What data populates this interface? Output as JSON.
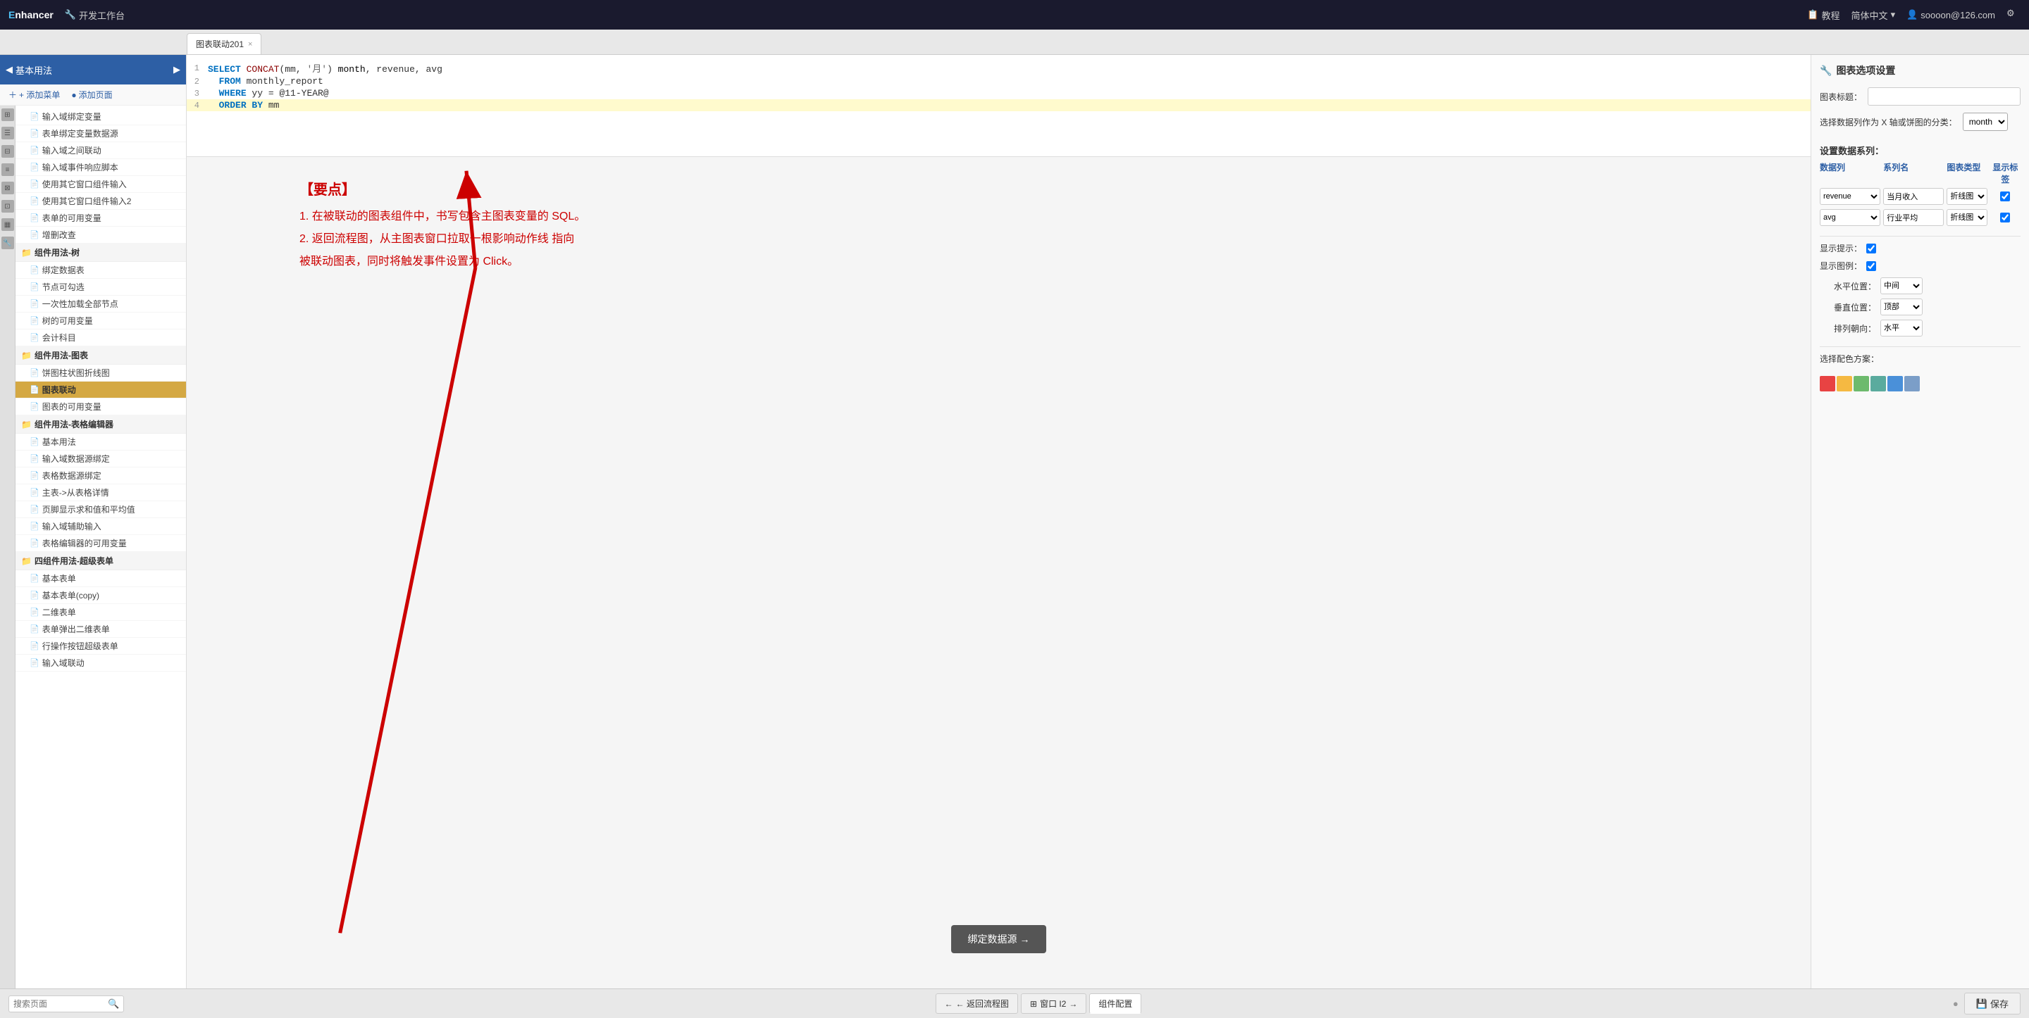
{
  "topbar": {
    "logo": "nhancer",
    "logo_prefix": "E",
    "workbench_icon": "🔧",
    "workbench_label": "开发工作台",
    "tutorial_label": "教程",
    "lang_label": "简体中文",
    "user_label": "soooon@126.com"
  },
  "tab": {
    "label": "图表联动201",
    "close": "×"
  },
  "sidebar": {
    "header": "基本用法",
    "add_menu_btn": "+ 添加菜单",
    "add_page_btn": "添加页面",
    "nav_items": [
      {
        "label": "输入域绑定变量",
        "type": "doc",
        "active": false
      },
      {
        "label": "表单绑定变量数据源",
        "type": "doc",
        "active": false
      },
      {
        "label": "输入域之间联动",
        "type": "doc",
        "active": false
      },
      {
        "label": "输入域事件响应脚本",
        "type": "doc",
        "active": false
      },
      {
        "label": "使用其它窗口组件输入",
        "type": "doc",
        "active": false
      },
      {
        "label": "使用其它窗口组件输入2",
        "type": "doc",
        "active": false
      },
      {
        "label": "表单的可用变量",
        "type": "doc",
        "active": false
      },
      {
        "label": "增删改查",
        "type": "doc",
        "active": false
      }
    ],
    "group_tree": {
      "label": "组件用法-树",
      "items": [
        "绑定数据表",
        "节点可勾选",
        "一次性加载全部节点",
        "树的可用变量",
        "会计科目"
      ]
    },
    "group_chart": {
      "label": "组件用法-图表",
      "items": [
        "饼图柱状图折线图",
        "图表联动",
        "图表的可用变量"
      ]
    },
    "group_table_editor": {
      "label": "组件用法-表格编辑器",
      "items": [
        "基本用法",
        "输入域数据源绑定",
        "表格数据源绑定",
        "主表->从表格详情",
        "页脚显示求和值和平均值",
        "输入域辅助输入",
        "表格编辑器的可用变量"
      ]
    },
    "group_super_table": {
      "label": "四组件用法-超级表单",
      "items": [
        "基本表单",
        "基本表单(copy)",
        "二维表单",
        "表单弹出二维表单",
        "行操作按钮超级表单",
        "输入域联动"
      ]
    },
    "search_placeholder": "搜索页面"
  },
  "editor": {
    "lines": [
      {
        "num": "1",
        "code": "SELECT CONCAT(mm, '月') month, revenue, avg"
      },
      {
        "num": "2",
        "code": "  FROM monthly_report"
      },
      {
        "num": "3",
        "code": "  WHERE yy = @11-YEAR@"
      },
      {
        "num": "4",
        "code": "  ORDER BY mm"
      }
    ]
  },
  "annotation": {
    "title": "【要点】",
    "points": [
      "1. 在被联动的图表组件中，书写包含主图表变量的 SQL。",
      "2. 返回流程图，从主图表窗口拉取一根影响动作线 指向",
      "   被联动图表，同时将触发事件设置为 Click。"
    ]
  },
  "bind_btn": "绑定数据源 →",
  "right_panel": {
    "title": "图表选项设置",
    "chart_title_label": "图表标题：",
    "chart_title_value": "",
    "x_axis_label": "选择数据列作为 X 轴或饼图的分类：",
    "x_axis_value": "month",
    "series_label": "设置数据系列：",
    "table_headers": {
      "col1": "数据列",
      "col2": "系列名",
      "col3": "图表类型",
      "col4": "显示标签"
    },
    "series_rows": [
      {
        "col1": "revenue",
        "col2": "当月收入",
        "col3": "折线图",
        "col4": true
      },
      {
        "col1": "avg",
        "col2": "行业平均",
        "col3": "折线图",
        "col4": true
      }
    ],
    "show_tip_label": "显示提示：",
    "show_tip_checked": true,
    "show_legend_label": "显示图例：",
    "show_legend_checked": true,
    "h_position_label": "水平位置：",
    "h_position_value": "中间",
    "v_position_label": "垂直位置：",
    "v_position_value": "顶部",
    "sort_direction_label": "排列朝向：",
    "sort_direction_value": "水平",
    "color_scheme_label": "选择配色方案：",
    "colors": [
      "#e84343",
      "#f5b942",
      "#6dba6d",
      "#5aab9e",
      "#4a90d9",
      "#7b9ec8"
    ]
  },
  "bottombar": {
    "back_btn": "← 返回流程图",
    "tab_window": "窗口 I2",
    "tab_config": "组件配置",
    "search_placeholder": "搜索页面",
    "save_btn": "保存"
  }
}
